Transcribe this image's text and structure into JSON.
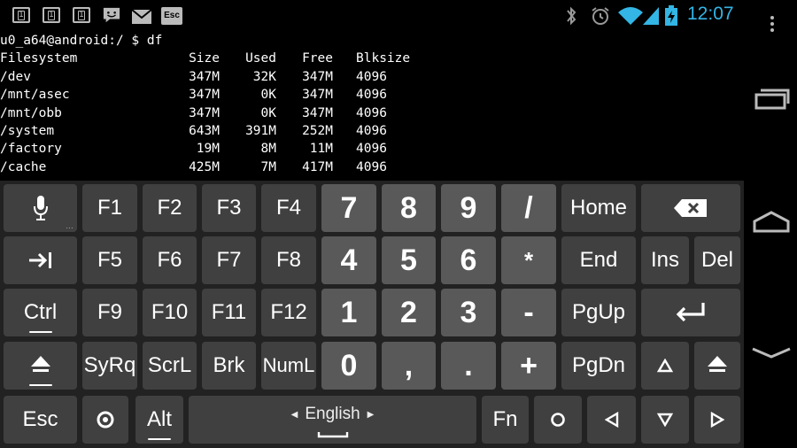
{
  "status": {
    "time": "12:07",
    "notifications": [
      {
        "name": "sim-card-1-icon"
      },
      {
        "name": "sim-card-1b-icon"
      },
      {
        "name": "sim-card-1c-icon"
      },
      {
        "name": "message-icon"
      },
      {
        "name": "email-icon"
      },
      {
        "name": "esc-icon",
        "label": "Esc"
      }
    ],
    "right_icons": [
      "bluetooth-icon",
      "alarm-icon",
      "wifi-icon",
      "signal-icon",
      "battery-charging-icon"
    ],
    "accent": "#33b5e5"
  },
  "terminal": {
    "prompt": "u0_a64@android:/ $ df",
    "header": {
      "fs": "Filesystem",
      "size": "Size",
      "used": "Used",
      "free": "Free",
      "blk": "Blksize"
    },
    "rows": [
      {
        "fs": "/dev",
        "size": "347M",
        "used": "32K",
        "free": "347M",
        "blk": "4096"
      },
      {
        "fs": "/mnt/asec",
        "size": "347M",
        "used": "0K",
        "free": "347M",
        "blk": "4096"
      },
      {
        "fs": "/mnt/obb",
        "size": "347M",
        "used": "0K",
        "free": "347M",
        "blk": "4096"
      },
      {
        "fs": "/system",
        "size": "643M",
        "used": "391M",
        "free": "252M",
        "blk": "4096"
      },
      {
        "fs": "/factory",
        "size": "19M",
        "used": "8M",
        "free": "11M",
        "blk": "4096"
      },
      {
        "fs": "/cache",
        "size": "425M",
        "used": "7M",
        "free": "417M",
        "blk": "4096"
      }
    ]
  },
  "keyboard": {
    "row1": {
      "f1": "F1",
      "f2": "F2",
      "f3": "F3",
      "f4": "F4",
      "k7": "7",
      "k8": "8",
      "k9": "9",
      "slash": "/",
      "home": "Home"
    },
    "row2": {
      "f5": "F5",
      "f6": "F6",
      "f7": "F7",
      "f8": "F8",
      "k4": "4",
      "k5": "5",
      "k6": "6",
      "star": "*",
      "end": "End",
      "ins": "Ins",
      "del": "Del"
    },
    "row3": {
      "ctrl": "Ctrl",
      "f9": "F9",
      "f10": "F10",
      "f11": "F11",
      "f12": "F12",
      "k1": "1",
      "k2": "2",
      "k3": "3",
      "minus": "-",
      "pgup": "PgUp"
    },
    "row4": {
      "sysrq": "SyRq",
      "scrl": "ScrL",
      "brk": "Brk",
      "numl": "NumL",
      "k0": "0",
      "comma": ",",
      "period": ".",
      "plus": "+",
      "pgdn": "PgDn"
    },
    "row5": {
      "esc": "Esc",
      "alt": "Alt",
      "language": "English",
      "fn": "Fn"
    }
  }
}
